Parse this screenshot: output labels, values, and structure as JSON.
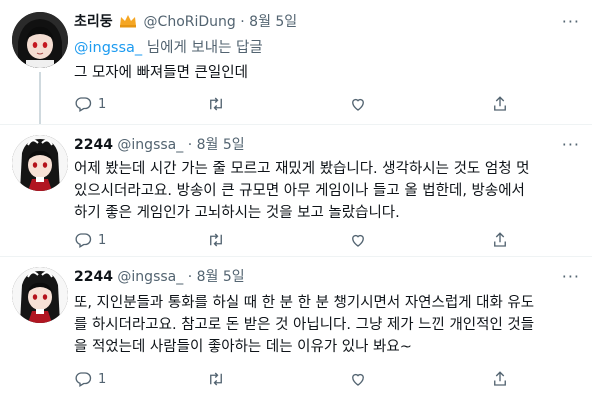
{
  "tweets": [
    {
      "name": "초리둥",
      "handle": "@ChoRiDung",
      "dot": "·",
      "time": "8월 5일",
      "reply_to_prefix": "@ingssa_",
      "reply_to_suffix": " 님에게 보내는 답글",
      "text": "그 모자에 빠져들면 큰일인데",
      "reply_count": "1",
      "more": "···"
    },
    {
      "name": "2244",
      "handle": "@ingssa_",
      "dot": "·",
      "time": "8월 5일",
      "text_lines": [
        "어제 봤는데 시간 가는 줄 모르고 재밌게 봤습니다. 생각하시는 것도 엄청 멋",
        "있으시더라고요. 방송이 큰 규모면 아무 게임이나 들고 올 법한데, 방송에서",
        "하기 좋은 게임인가 고뇌하시는 것을 보고 놀랐습니다."
      ],
      "reply_count": "1",
      "more": "···"
    },
    {
      "name": "2244",
      "handle": "@ingssa_",
      "dot": "·",
      "time": "8월 5일",
      "text_lines": [
        "또, 지인분들과 통화를 하실 때 한 분 한 분 챙기시면서 자연스럽게 대화 유도",
        "를 하시더라고요. 참고로 돈 받은 것 아닙니다. 그냥 제가 느낀 개인적인 것들",
        "을 적었는데 사람들이 좋아하는 데는 이유가 있나 봐요~"
      ],
      "reply_count": "1",
      "more": "···"
    }
  ],
  "icons": [
    "reply-icon",
    "retweet-icon",
    "like-icon",
    "share-icon",
    "crown-icon"
  ],
  "colors": {
    "link": "#1d9bf0",
    "muted": "#536471",
    "text": "#0f1419",
    "crown": "#f5a623"
  }
}
